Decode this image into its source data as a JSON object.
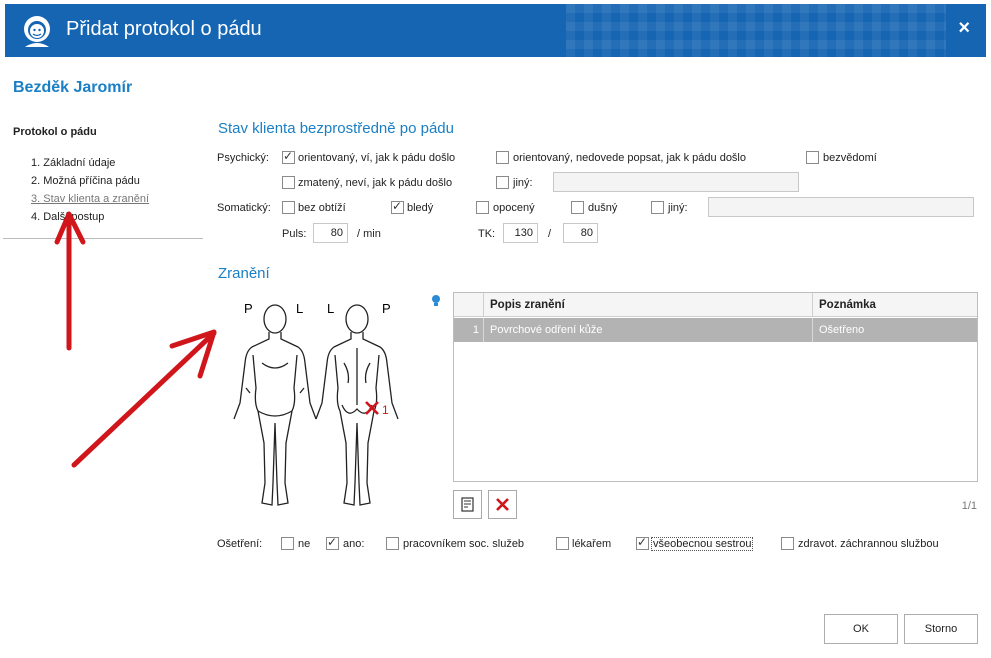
{
  "window": {
    "title": "Přidat protokol o pádu",
    "close_label": "×"
  },
  "client": {
    "name": "Bezděk Jaromír"
  },
  "sidebar": {
    "heading": "Protokol o pádu",
    "items": [
      {
        "label": "1. Základní údaje"
      },
      {
        "label": "2. Možná příčina pádu"
      },
      {
        "label": "3. Stav klienta a zranění"
      },
      {
        "label": "4. Další postup"
      }
    ],
    "active_index": 2
  },
  "state_section": {
    "title": "Stav klienta bezprostředně po pádu",
    "psychic_label": "Psychický:",
    "psychic_options": [
      {
        "label": "orientovaný, ví, jak k pádu došlo",
        "checked": true
      },
      {
        "label": "orientovaný, nedovede popsat, jak k pádu došlo",
        "checked": false
      },
      {
        "label": "bezvědomí",
        "checked": false
      },
      {
        "label": "zmatený, neví, jak k pádu došlo",
        "checked": false
      },
      {
        "label": "jiný:",
        "checked": false
      }
    ],
    "psychic_other_value": "",
    "somatic_label": "Somatický:",
    "somatic_options": [
      {
        "label": "bez obtíží",
        "checked": false
      },
      {
        "label": "bledý",
        "checked": true
      },
      {
        "label": "opocený",
        "checked": false
      },
      {
        "label": "dušný",
        "checked": false
      },
      {
        "label": "jiný:",
        "checked": false
      }
    ],
    "somatic_other_value": "",
    "pulse_label": "Puls:",
    "pulse_value": "80",
    "pulse_unit": "/ min",
    "tk_label": "TK:",
    "tk_systolic": "130",
    "tk_separator": "/",
    "tk_diastolic": "80"
  },
  "injury_section": {
    "title": "Zranění",
    "figure_labels": {
      "front_left": "P",
      "front_right": "L",
      "back_left": "L",
      "back_right": "P"
    },
    "marker_number": "1",
    "table": {
      "columns": [
        "",
        "Popis zranění",
        "Poznámka"
      ],
      "rows": [
        {
          "num": "1",
          "description": "Povrchové odření kůže",
          "note": "Ošetřeno"
        }
      ]
    },
    "pager": "1/1"
  },
  "treatment": {
    "label": "Ošetření:",
    "options": [
      {
        "label": "ne",
        "checked": false
      },
      {
        "label": "ano:",
        "checked": true
      },
      {
        "label": "pracovníkem soc. služeb",
        "checked": false
      },
      {
        "label": "lékařem",
        "checked": false
      },
      {
        "label": "všeobecnou sestrou",
        "checked": true
      },
      {
        "label": "zdravot. záchrannou službou",
        "checked": false
      }
    ]
  },
  "footer": {
    "ok_label": "OK",
    "cancel_label": "Storno"
  },
  "colors": {
    "titlebar": "#1565b3",
    "accent": "#1a7fc4",
    "selected_row": "#b3b3b3",
    "annotation_arrow": "#d0161b"
  }
}
